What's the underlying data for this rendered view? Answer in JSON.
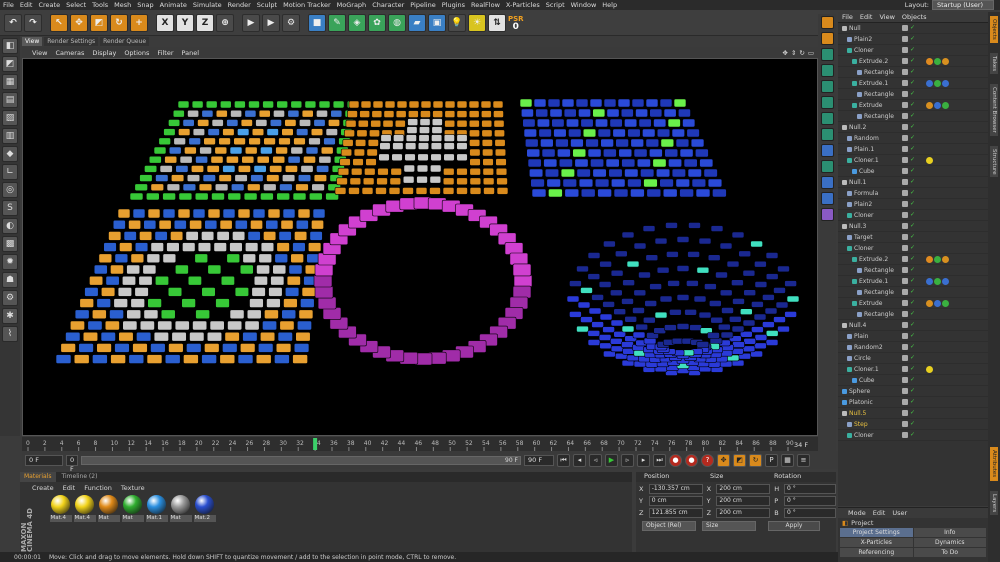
{
  "menu": [
    "File",
    "Edit",
    "Create",
    "Select",
    "Tools",
    "Mesh",
    "Snap",
    "Animate",
    "Simulate",
    "Render",
    "Sculpt",
    "Motion Tracker",
    "MoGraph",
    "Character",
    "Pipeline",
    "Plugins",
    "RealFlow",
    "X-Particles",
    "Script",
    "Window",
    "Help"
  ],
  "layout": {
    "label": "Layout:",
    "value": "Startup (User)"
  },
  "toolbar": {
    "x": "X",
    "y": "Y",
    "z": "Z",
    "psr": "PSR",
    "psr_value": "0"
  },
  "viewport_tabs": [
    "View",
    "Render Settings",
    "Render Queue"
  ],
  "viewport_menu": [
    "View",
    "Cameras",
    "Display",
    "Options",
    "Filter",
    "Panel"
  ],
  "timeline": {
    "ticks": [
      "0",
      "2",
      "4",
      "6",
      "8",
      "10",
      "12",
      "14",
      "16",
      "18",
      "20",
      "22",
      "24",
      "26",
      "28",
      "30",
      "32",
      "34",
      "36",
      "38",
      "40",
      "42",
      "44",
      "46",
      "48",
      "50",
      "52",
      "54",
      "56",
      "58",
      "60",
      "62",
      "64",
      "66",
      "68",
      "70",
      "72",
      "74",
      "76",
      "78",
      "80",
      "82",
      "84",
      "86",
      "88",
      "90"
    ],
    "current": "34",
    "end": "34 F"
  },
  "playback": {
    "start": "0 F",
    "min": "0 F",
    "max": "90 F",
    "end": "90 F"
  },
  "object_menu": [
    "File",
    "Edit",
    "View",
    "Objects"
  ],
  "objects": [
    {
      "name": "Null",
      "indent": 0,
      "icon": "null",
      "tags": []
    },
    {
      "name": "Plain2",
      "indent": 1,
      "icon": "effector",
      "tags": []
    },
    {
      "name": "Cloner",
      "indent": 1,
      "icon": "cloner",
      "tags": []
    },
    {
      "name": "Extrude.2",
      "indent": 2,
      "icon": "extrude",
      "tags": [
        "#e08a20",
        "#3ab040",
        "#d89020"
      ]
    },
    {
      "name": "Rectangle",
      "indent": 3,
      "icon": "spline",
      "tags": []
    },
    {
      "name": "Extrude.1",
      "indent": 2,
      "icon": "extrude",
      "tags": [
        "#3a6fd0",
        "#3ab040",
        "#3a6fd0"
      ]
    },
    {
      "name": "Rectangle",
      "indent": 3,
      "icon": "spline",
      "tags": []
    },
    {
      "name": "Extrude",
      "indent": 2,
      "icon": "extrude",
      "tags": [
        "#d89020",
        "#3a6fd0",
        "#3ab040"
      ]
    },
    {
      "name": "Rectangle",
      "indent": 3,
      "icon": "spline",
      "tags": []
    },
    {
      "name": "Null.2",
      "indent": 0,
      "icon": "null",
      "tags": []
    },
    {
      "name": "Random",
      "indent": 1,
      "icon": "effector",
      "tags": []
    },
    {
      "name": "Plain.1",
      "indent": 1,
      "icon": "effector",
      "tags": []
    },
    {
      "name": "Cloner.1",
      "indent": 1,
      "icon": "cloner",
      "tags": [
        "#e8d020"
      ]
    },
    {
      "name": "Cube",
      "indent": 2,
      "icon": "cube",
      "tags": []
    },
    {
      "name": "Null.1",
      "indent": 0,
      "icon": "null",
      "tags": []
    },
    {
      "name": "Formula",
      "indent": 1,
      "icon": "effector",
      "tags": []
    },
    {
      "name": "Plain2",
      "indent": 1,
      "icon": "effector",
      "tags": []
    },
    {
      "name": "Cloner",
      "indent": 1,
      "icon": "cloner",
      "tags": []
    },
    {
      "name": "Null.3",
      "indent": 0,
      "icon": "null",
      "tags": []
    },
    {
      "name": "Target",
      "indent": 1,
      "icon": "effector",
      "tags": []
    },
    {
      "name": "Cloner",
      "indent": 1,
      "icon": "cloner",
      "tags": []
    },
    {
      "name": "Extrude.2",
      "indent": 2,
      "icon": "extrude",
      "tags": [
        "#e08a20",
        "#3ab040",
        "#d89020"
      ]
    },
    {
      "name": "Rectangle",
      "indent": 3,
      "icon": "spline",
      "tags": []
    },
    {
      "name": "Extrude.1",
      "indent": 2,
      "icon": "extrude",
      "tags": [
        "#3a6fd0",
        "#3ab040",
        "#3a6fd0"
      ]
    },
    {
      "name": "Rectangle",
      "indent": 3,
      "icon": "spline",
      "tags": []
    },
    {
      "name": "Extrude",
      "indent": 2,
      "icon": "extrude",
      "tags": [
        "#d89020",
        "#3a6fd0",
        "#3ab040"
      ]
    },
    {
      "name": "Rectangle",
      "indent": 3,
      "icon": "spline",
      "tags": []
    },
    {
      "name": "Null.4",
      "indent": 0,
      "icon": "null",
      "tags": []
    },
    {
      "name": "Plain",
      "indent": 1,
      "icon": "effector",
      "tags": []
    },
    {
      "name": "Random2",
      "indent": 1,
      "icon": "effector",
      "tags": []
    },
    {
      "name": "Circle",
      "indent": 1,
      "icon": "spline",
      "tags": []
    },
    {
      "name": "Cloner.1",
      "indent": 1,
      "icon": "cloner",
      "tags": [
        "#e8d020"
      ]
    },
    {
      "name": "Cube",
      "indent": 2,
      "icon": "cube",
      "tags": []
    },
    {
      "name": "Sphere",
      "indent": 0,
      "icon": "sphere",
      "tags": []
    },
    {
      "name": "Platonic",
      "indent": 0,
      "icon": "sphere",
      "tags": []
    },
    {
      "name": "Null.5",
      "indent": 0,
      "icon": "null",
      "tags": [],
      "selected": true
    },
    {
      "name": "Step",
      "indent": 1,
      "icon": "effector",
      "tags": [],
      "selected": true
    },
    {
      "name": "Cloner",
      "indent": 1,
      "icon": "cloner",
      "tags": []
    }
  ],
  "right_tabs": [
    "Objects",
    "Takes",
    "Content Browser",
    "Structure",
    "Attributes",
    "Layers"
  ],
  "attributes": {
    "menu": [
      "Mode",
      "Edit",
      "User"
    ],
    "title": "Project",
    "tabs": [
      "Project Settings",
      "Info",
      "X-Particles",
      "Dynamics",
      "Referencing",
      "To Do"
    ]
  },
  "material_tabs": [
    "Materials",
    "Timeline (2)"
  ],
  "material_menu": [
    "Create",
    "Edit",
    "Function",
    "Texture"
  ],
  "materials": [
    {
      "name": "Mat.4",
      "color": "#f2d31a"
    },
    {
      "name": "Mat.4",
      "color": "#f2d31a"
    },
    {
      "name": "Mat",
      "color": "#e08a18"
    },
    {
      "name": "Mat",
      "color": "#2fae2f"
    },
    {
      "name": "Mat.1",
      "color": "#2a8fe0"
    },
    {
      "name": "Mat",
      "color": "#9a9a9a"
    },
    {
      "name": "Mat.2",
      "color": "#2a4fd0"
    }
  ],
  "maxon": "MAXON CINEMA 4D",
  "coords": {
    "headers": [
      "Position",
      "Size",
      "Rotation"
    ],
    "rows": [
      {
        "axis": "X",
        "pos": "-130.357 cm",
        "size_axis": "X",
        "size": "200 cm",
        "rot_axis": "H",
        "rot": "0 °"
      },
      {
        "axis": "Y",
        "pos": "0 cm",
        "size_axis": "Y",
        "size": "200 cm",
        "rot_axis": "P",
        "rot": "0 °"
      },
      {
        "axis": "Z",
        "pos": "121.855 cm",
        "size_axis": "Z",
        "size": "200 cm",
        "rot_axis": "B",
        "rot": "0 °"
      }
    ],
    "mode": "Object (Rel)",
    "size_mode": "Size",
    "apply": "Apply"
  },
  "status": {
    "time": "00:00:01",
    "message": "Move: Click and drag to move elements. Hold down SHIFT to quantize movement / add to the selection in point mode, CTRL to remove."
  },
  "colors": {
    "orange": "#d98a1c",
    "green": "#37c837",
    "blue": "#2a5fd0",
    "magenta": "#d040d0"
  }
}
